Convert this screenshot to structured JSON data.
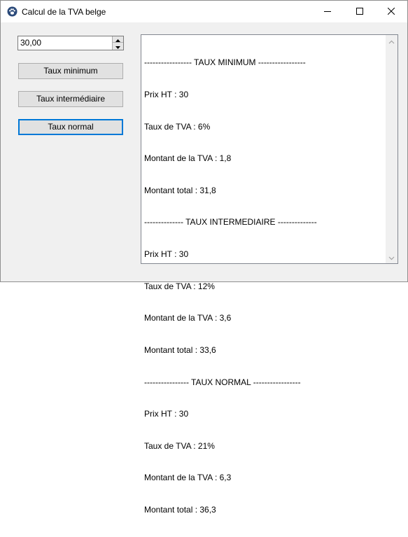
{
  "window": {
    "title": "Calcul de la TVA belge",
    "icons": {
      "app": "paw-icon",
      "minimize": "minimize-icon",
      "maximize": "maximize-icon",
      "close": "close-icon"
    }
  },
  "spinner": {
    "value": "30,00"
  },
  "buttons": {
    "minimum": "Taux minimum",
    "intermediaire": "Taux intermédiaire",
    "normal": "Taux normal"
  },
  "output": {
    "lines": [
      "----------------- TAUX MINIMUM -----------------",
      "Prix HT : 30",
      "Taux de TVA : 6%",
      "Montant de la TVA : 1,8",
      "Montant total : 31,8",
      "-------------- TAUX INTERMEDIAIRE --------------",
      "Prix HT : 30",
      "Taux de TVA : 12%",
      "Montant de la TVA : 3,6",
      "Montant total : 33,6",
      "---------------- TAUX NORMAL -----------------",
      "Prix HT : 30",
      "Taux de TVA : 21%",
      "Montant de la TVA : 6,3",
      "Montant total : 36,3"
    ]
  },
  "colors": {
    "accent": "#0078d7",
    "window_bg": "#f0f0f0"
  }
}
